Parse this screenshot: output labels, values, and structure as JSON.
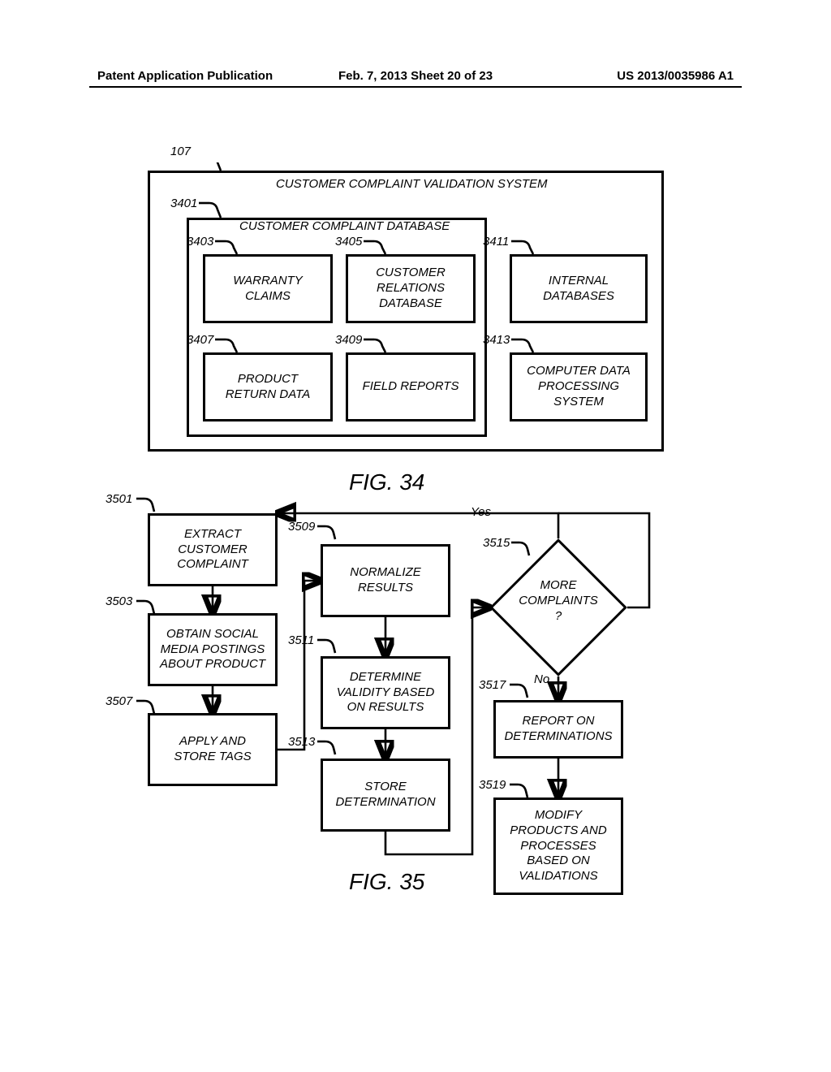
{
  "header": {
    "left": "Patent Application Publication",
    "center": "Feb. 7, 2013  Sheet 20 of 23",
    "right": "US 2013/0035986 A1"
  },
  "fig34": {
    "caption": "FIG. 34",
    "title": "CUSTOMER COMPLAINT VALIDATION SYSTEM",
    "db_title": "CUSTOMER COMPLAINT DATABASE",
    "refs": {
      "outer": "107",
      "db": "3401",
      "warranty": "3403",
      "custrel": "3405",
      "prodret": "3407",
      "field": "3409",
      "internal": "3411",
      "cdp": "3413"
    },
    "boxes": {
      "warranty": "WARRANTY\nCLAIMS",
      "custrel": "CUSTOMER\nRELATIONS\nDATABASE",
      "prodret": "PRODUCT\nRETURN DATA",
      "field": "FIELD REPORTS",
      "internal": "INTERNAL\nDATABASES",
      "cdp": "COMPUTER DATA\nPROCESSING\nSYSTEM"
    }
  },
  "fig35": {
    "caption": "FIG. 35",
    "refs": {
      "extract": "3501",
      "obtain": "3503",
      "apply": "3507",
      "normalize": "3509",
      "determine": "3511",
      "store": "3513",
      "more": "3515",
      "report": "3517",
      "modify": "3519"
    },
    "boxes": {
      "extract": "EXTRACT\nCUSTOMER\nCOMPLAINT",
      "obtain": "OBTAIN SOCIAL\nMEDIA POSTINGS\nABOUT PRODUCT",
      "apply": "APPLY AND\nSTORE TAGS",
      "normalize": "NORMALIZE\nRESULTS",
      "determine": "DETERMINE\nVALIDITY BASED\nON  RESULTS",
      "store": "STORE\nDETERMINATION",
      "report": "REPORT ON\nDETERMINATIONS",
      "modify": "MODIFY\nPRODUCTS AND\nPROCESSES\nBASED ON\nVALIDATIONS"
    },
    "decision": "MORE\nCOMPLAINTS\n?",
    "labels": {
      "yes": "Yes",
      "no": "No"
    }
  }
}
